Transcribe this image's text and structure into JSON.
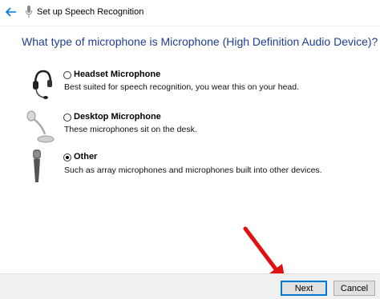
{
  "window": {
    "title": "Set up Speech Recognition"
  },
  "question": "What type of microphone is Microphone (High Definition Audio Device)?",
  "options": [
    {
      "label": "Headset Microphone",
      "description": "Best suited for speech recognition, you wear this on your head.",
      "selected": false,
      "icon": "headset-icon"
    },
    {
      "label": "Desktop Microphone",
      "description": "These microphones sit on the desk.",
      "selected": false,
      "icon": "desktop-microphone-icon"
    },
    {
      "label": "Other",
      "description": "Such as array microphones and microphones built into other devices.",
      "selected": true,
      "icon": "handheld-microphone-icon"
    }
  ],
  "buttons": {
    "next": "Next",
    "cancel": "Cancel"
  },
  "colors": {
    "question": "#1f3d96",
    "accent": "#0078d7",
    "annotation_arrow": "#e01010"
  }
}
